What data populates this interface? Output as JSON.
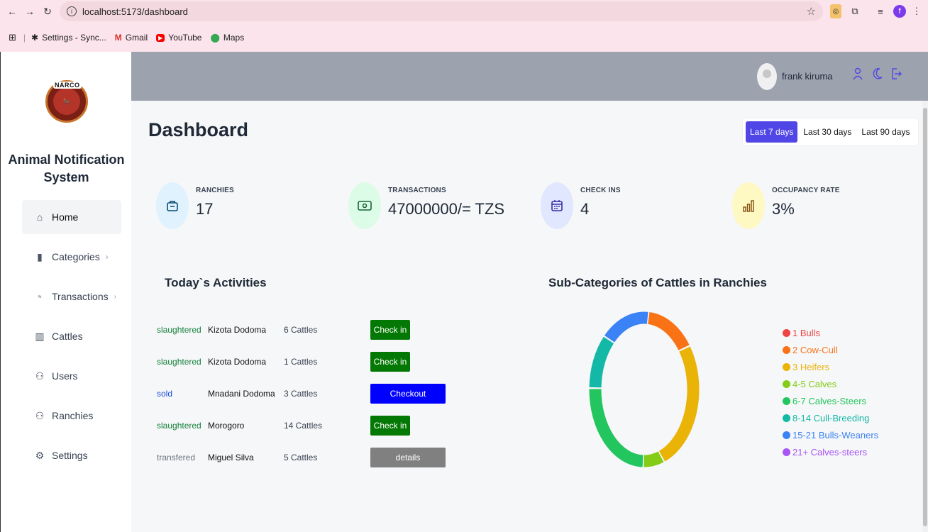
{
  "browser": {
    "url": "localhost:5173/dashboard",
    "bookmarks": [
      {
        "label": "Settings - Sync...",
        "icon": "gear-icon"
      },
      {
        "label": "Gmail",
        "icon": "gmail-icon"
      },
      {
        "label": "YouTube",
        "icon": "youtube-icon"
      },
      {
        "label": "Maps",
        "icon": "maps-icon"
      }
    ],
    "profile_letter": "f"
  },
  "sidebar": {
    "logo_text": "NARCO",
    "app_name_line1": "Animal Notification",
    "app_name_line2": "System",
    "items": [
      {
        "label": "Home",
        "icon": "home-icon",
        "active": true
      },
      {
        "label": "Categories",
        "icon": "bar-chart-icon",
        "chevron": true
      },
      {
        "label": "Transactions",
        "icon": "transactions-icon",
        "chevron": true
      },
      {
        "label": "Cattles",
        "icon": "building-icon"
      },
      {
        "label": "Users",
        "icon": "users-icon"
      },
      {
        "label": "Ranchies",
        "icon": "users-icon"
      },
      {
        "label": "Settings",
        "icon": "gear-icon"
      }
    ]
  },
  "header": {
    "username": "frank kiruma",
    "icons": [
      "user-icon",
      "moon-icon",
      "logout-icon"
    ]
  },
  "main": {
    "title": "Dashboard",
    "ranges": [
      {
        "label": "Last 7 days",
        "active": true
      },
      {
        "label": "Last 30 days",
        "active": false
      },
      {
        "label": "Last 90 days",
        "active": false
      }
    ],
    "stats": [
      {
        "label": "RANCHIES",
        "value": "17",
        "icon": "briefcase-icon",
        "bg": "#e0f2fe",
        "fg": "#0369a1"
      },
      {
        "label": "TRANSACTIONS",
        "value": "47000000/= TZS",
        "icon": "money-icon",
        "bg": "#dcfce7",
        "fg": "#15803d"
      },
      {
        "label": "CHECK INS",
        "value": "4",
        "icon": "calendar-icon",
        "bg": "#e0e7ff",
        "fg": "#4338ca"
      },
      {
        "label": "OCCUPANCY RATE",
        "value": "3%",
        "icon": "chart-icon",
        "bg": "#fef9c3",
        "fg": "#a16207"
      }
    ],
    "activities_title": "Today`s Activities",
    "activities": [
      {
        "status": "slaughtered",
        "status_color": "#15803d",
        "place": "Kizota Dodoma",
        "count": "6 Cattles",
        "button": "Check in",
        "button_color": "#047804"
      },
      {
        "status": "slaughtered",
        "status_color": "#15803d",
        "place": "Kizota Dodoma",
        "count": "1 Cattles",
        "button": "Check in",
        "button_color": "#047804"
      },
      {
        "status": "sold",
        "status_color": "#1d4ed8",
        "place": "Mnadani Dodoma",
        "count": "3 Cattles",
        "button": "Checkout",
        "button_color": "#0000ff"
      },
      {
        "status": "slaughtered",
        "status_color": "#15803d",
        "place": "Morogoro",
        "count": "14 Cattles",
        "button": "Check in",
        "button_color": "#047804"
      },
      {
        "status": "transfered",
        "status_color": "#6b7280",
        "place": "Miguel Silva",
        "count": "5 Cattles",
        "button": "details",
        "button_color": "#808080"
      }
    ],
    "subcat_title": "Sub-Categories of Cattles in Ranchies"
  },
  "chart_data": {
    "type": "pie",
    "donut": true,
    "categories": [
      "1 Bulls",
      "2 Cow-Cull",
      "3 Heifers",
      "4-5 Calves",
      "6-7 Calves-Steers",
      "8-14 Cull-Breeding",
      "15-21 Bulls-Weaners",
      "21+ Calves-steers"
    ],
    "values": [
      0,
      14,
      29,
      6,
      25,
      12,
      14,
      0
    ],
    "colors": [
      "#ef4444",
      "#f97316",
      "#eab308",
      "#84cc16",
      "#22c55e",
      "#14b8a6",
      "#3b82f6",
      "#a855f7"
    ],
    "legend": "right"
  }
}
